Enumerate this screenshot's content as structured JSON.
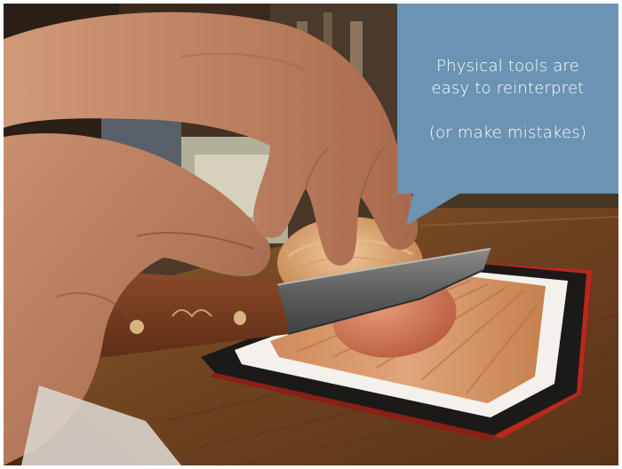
{
  "slide": {
    "callout": {
      "line1": "Physical tools are",
      "line2": "easy to reinterpret",
      "line3": "(or make mistakes)"
    }
  },
  "colors": {
    "callout_fill": "#6b93b2",
    "callout_text": "#ffffff",
    "counter_wood": "#7a4a22",
    "tablet_case": "#b8281c"
  },
  "icons": [
    "speech-bubble-callout"
  ]
}
